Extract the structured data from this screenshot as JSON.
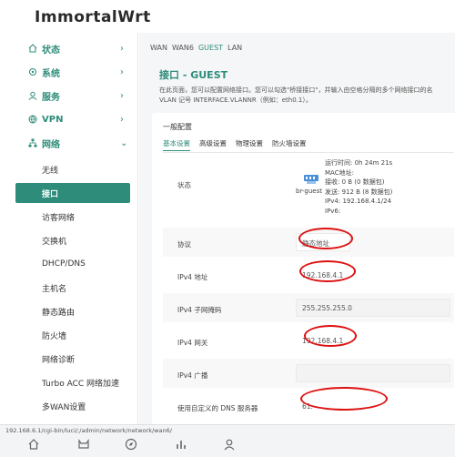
{
  "brand": {
    "title": "ImmortalWrt"
  },
  "sidebar": {
    "menus": [
      {
        "label": "状态",
        "icon": "home-icon"
      },
      {
        "label": "系统",
        "icon": "gear-icon"
      },
      {
        "label": "服务",
        "icon": "user-icon"
      },
      {
        "label": "VPN",
        "icon": "vpn-icon"
      },
      {
        "label": "网络",
        "icon": "network-icon"
      }
    ],
    "subitems": [
      "无线",
      "接口",
      "访客网络",
      "交换机",
      "DHCP/DNS",
      "主机名",
      "静态路由",
      "防火墙",
      "网络诊断",
      "Turbo ACC 网络加速",
      "多WAN设置"
    ],
    "active_sub": "接口"
  },
  "main": {
    "top_tabs": [
      "WAN",
      "WAN6",
      "GUEST",
      "LAN"
    ],
    "active_tab": "GUEST",
    "title": "接口 - GUEST",
    "desc_line1": "在此页面，您可以配置网络接口。您可以勾选\"桥接接口\"，并输入由空格分隔的多个网络接口的名",
    "desc_line2": "VLAN 记号 INTERFACE.VLANNR（例如：eth0.1）。",
    "card_title": "一般配置",
    "card_tabs": [
      "基本设置",
      "高级设置",
      "物理设置",
      "防火墙设置"
    ],
    "status": {
      "label": "状态",
      "iface_label": "br-guest",
      "lines": [
        "运行时间: 0h 24m 21s",
        "MAC地址:",
        "接收: 0 B (0 数据包)",
        "发送: 912 B (8 数据包)",
        "IPv4: 192.168.4.1/24",
        "IPv6:"
      ]
    },
    "rows": [
      {
        "label": "协议",
        "value": "静态地址"
      },
      {
        "label": "IPv4 地址",
        "value": "192.168.4.1"
      },
      {
        "label": "IPv4 子网掩码",
        "value": "255.255.255.0"
      },
      {
        "label": "IPv4 网关",
        "value": "192.168.4.1"
      },
      {
        "label": "IPv4 广播",
        "value": ""
      },
      {
        "label": "使用自定义的 DNS 服务器",
        "value": "61."
      }
    ]
  },
  "urlbar": {
    "url": "192.168.6.1/cgi-bin/luci/;/admin/network/network/wan6/"
  },
  "colors": {
    "accent": "#2d8c7a",
    "annotation": "#dd1111"
  }
}
